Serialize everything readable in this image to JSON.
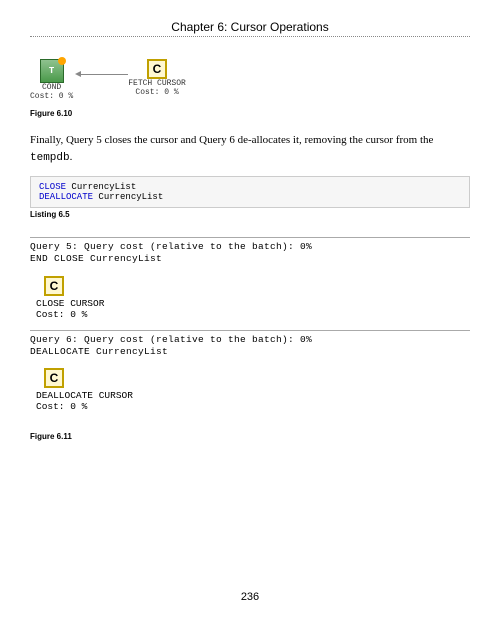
{
  "chapter_title": "Chapter 6: Cursor Operations",
  "figure_6_10": {
    "label": "Figure 6.10",
    "left_node": {
      "name": "COND",
      "cost": "Cost: 0 %"
    },
    "right_node": {
      "name": "FETCH CURSOR",
      "cost": "Cost: 0 %",
      "letter": "C"
    }
  },
  "para1_a": "Finally, Query 5 closes the cursor and Query 6 de-allocates it, removing the cursor from the ",
  "para1_code": "tempdb",
  "para1_b": ".",
  "listing_6_5": {
    "label": "Listing 6.5",
    "line1_kw": "CLOSE",
    "line1_rest": " CurrencyList",
    "line2_kw": "DEALLOCATE",
    "line2_rest": " CurrencyList"
  },
  "query5": {
    "head1": "Query 5: Query cost (relative to the batch): 0%",
    "head2": "END CLOSE CurrencyList",
    "op_letter": "C",
    "op_name": "CLOSE CURSOR",
    "op_cost": "Cost: 0 %"
  },
  "query6": {
    "head1": "Query 6: Query cost (relative to the batch): 0%",
    "head2": "DEALLOCATE CurrencyList",
    "op_letter": "C",
    "op_name": "DEALLOCATE CURSOR",
    "op_cost": "Cost: 0 %"
  },
  "figure_6_11_label": "Figure 6.11",
  "page_number": "236"
}
